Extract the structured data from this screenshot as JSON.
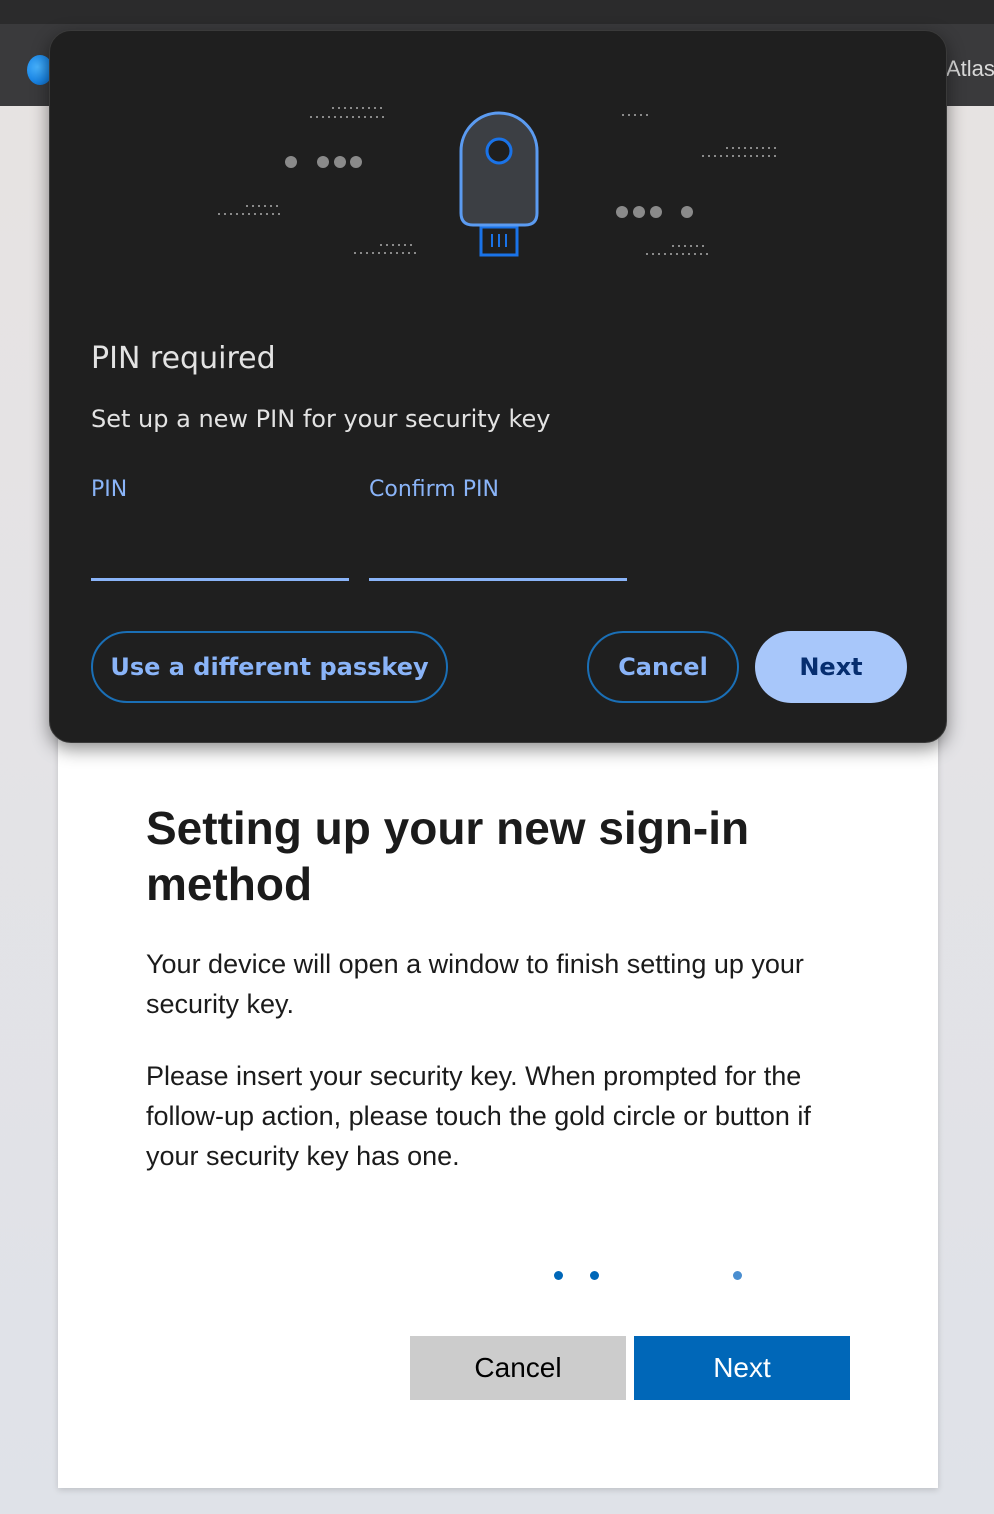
{
  "browser": {
    "tab_title": "Atlas",
    "favicon_icon": "edge-browser-icon"
  },
  "dialog": {
    "illustration_icon": "security-key-icon",
    "title": "PIN required",
    "subtitle": "Set up a new PIN for your security key",
    "pin_label": "PIN",
    "pin_value": "",
    "confirm_pin_label": "Confirm PIN",
    "confirm_pin_value": "",
    "different_passkey_label": "Use a different passkey",
    "cancel_label": "Cancel",
    "next_label": "Next",
    "colors": {
      "background": "#1f1f1f",
      "accent": "#8ab4f8",
      "primary_button": "#a8c7fa",
      "primary_button_text": "#062e6f"
    }
  },
  "page": {
    "title": "Setting up your new sign-in method",
    "paragraph1": "Your device will open a window to finish setting up your security key.",
    "paragraph2": "Please insert your security key. When prompted for the follow-up action, please touch the gold circle or button if your security key has one.",
    "cancel_label": "Cancel",
    "next_label": "Next",
    "colors": {
      "accent": "#0067b8",
      "cancel_button": "#cccccc"
    }
  }
}
